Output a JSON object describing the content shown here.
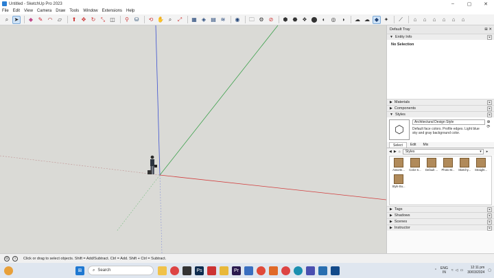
{
  "window": {
    "title": "Untitled - SketchUp Pro 2023",
    "minimize": "–",
    "maximize": "▢",
    "close": "✕"
  },
  "menu": [
    "File",
    "Edit",
    "View",
    "Camera",
    "Draw",
    "Tools",
    "Window",
    "Extensions",
    "Help"
  ],
  "toolbar": {
    "icons": [
      "search-icon",
      "select-icon",
      "eraser-icon",
      "pencil-icon",
      "arc-icon",
      "rectangle-icon",
      "push-pull-icon",
      "move-icon",
      "rotate-icon",
      "scale-icon",
      "offset-icon",
      "tape-icon",
      "paint-icon",
      "orbit-icon",
      "pan-icon",
      "zoom-icon",
      "zoom-extents-icon",
      "warehouse-icon",
      "extension-icon",
      "styles-icon",
      "camera-icon",
      "folder-icon",
      "gear-icon",
      "no-entry-icon",
      "cloud-icon"
    ]
  },
  "panel": {
    "title": "Default Tray",
    "entity_info": {
      "label": "Entity Info",
      "selection": "No Selection"
    },
    "materials": "Materials",
    "components": "Components",
    "styles": {
      "label": "Styles",
      "name": "Architectural Design Style",
      "description": "Default face colors. Profile edges. Light blue sky and gray background color.",
      "tabs": [
        "Select",
        "Edit",
        "Mix"
      ],
      "dropdown": "Styles",
      "items": [
        "Assorte...",
        "Color S...",
        "Default ...",
        "Photo M...",
        "Sketchy...",
        "Straight...",
        "Style Bu..."
      ]
    },
    "tags": "Tags",
    "shadows": "Shadows",
    "scenes": "Scenes",
    "instructor": "Instructor"
  },
  "status": {
    "text": "Click or drag to select objects. Shift = Add/Subtract. Ctrl = Add. Shift + Ctrl = Subtract."
  },
  "taskbar": {
    "search": "Search",
    "lang": "ENG",
    "region": "IN",
    "time": "12:11 pm",
    "date": "30/03/2024"
  },
  "colors": {
    "axis_red": "#d23c3c",
    "axis_green": "#3aa04a",
    "axis_blue": "#3a4fd0",
    "viewport": "#dadad6"
  }
}
